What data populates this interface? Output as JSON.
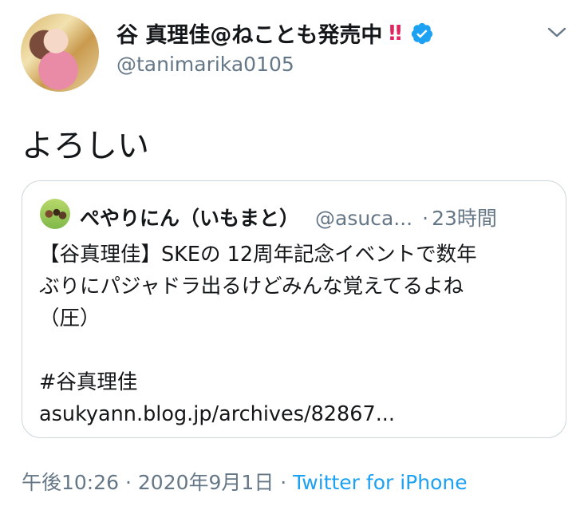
{
  "author": {
    "display_name": "谷 真理佳@ねことも発売中",
    "emoji": "‼",
    "handle": "@tanimarika0105",
    "verified_icon": "verified-badge-icon"
  },
  "tweet": {
    "text": "よろしい"
  },
  "quoted": {
    "display_name": "ぺやりにん（いもまと）",
    "handle": "@asuca...",
    "separator": "·",
    "time": "23時間",
    "lines": [
      "【谷真理佳】SKEの 12周年記念イベントで数年",
      "ぶりにパジャドラ出るけどみんな覚えてるよね",
      "（圧）"
    ],
    "hashtag": "#谷真理佳",
    "link": "asukyann.blog.jp/archives/82867..."
  },
  "meta": {
    "time": "午後10:26",
    "sep1": " · ",
    "date": "2020年9月1日",
    "sep2": " · ",
    "source": "Twitter for iPhone"
  },
  "colors": {
    "accent": "#1da1f2",
    "text": "#14171a",
    "muted": "#657786",
    "border": "#ccd6dd",
    "emoji": "#e0245e"
  }
}
